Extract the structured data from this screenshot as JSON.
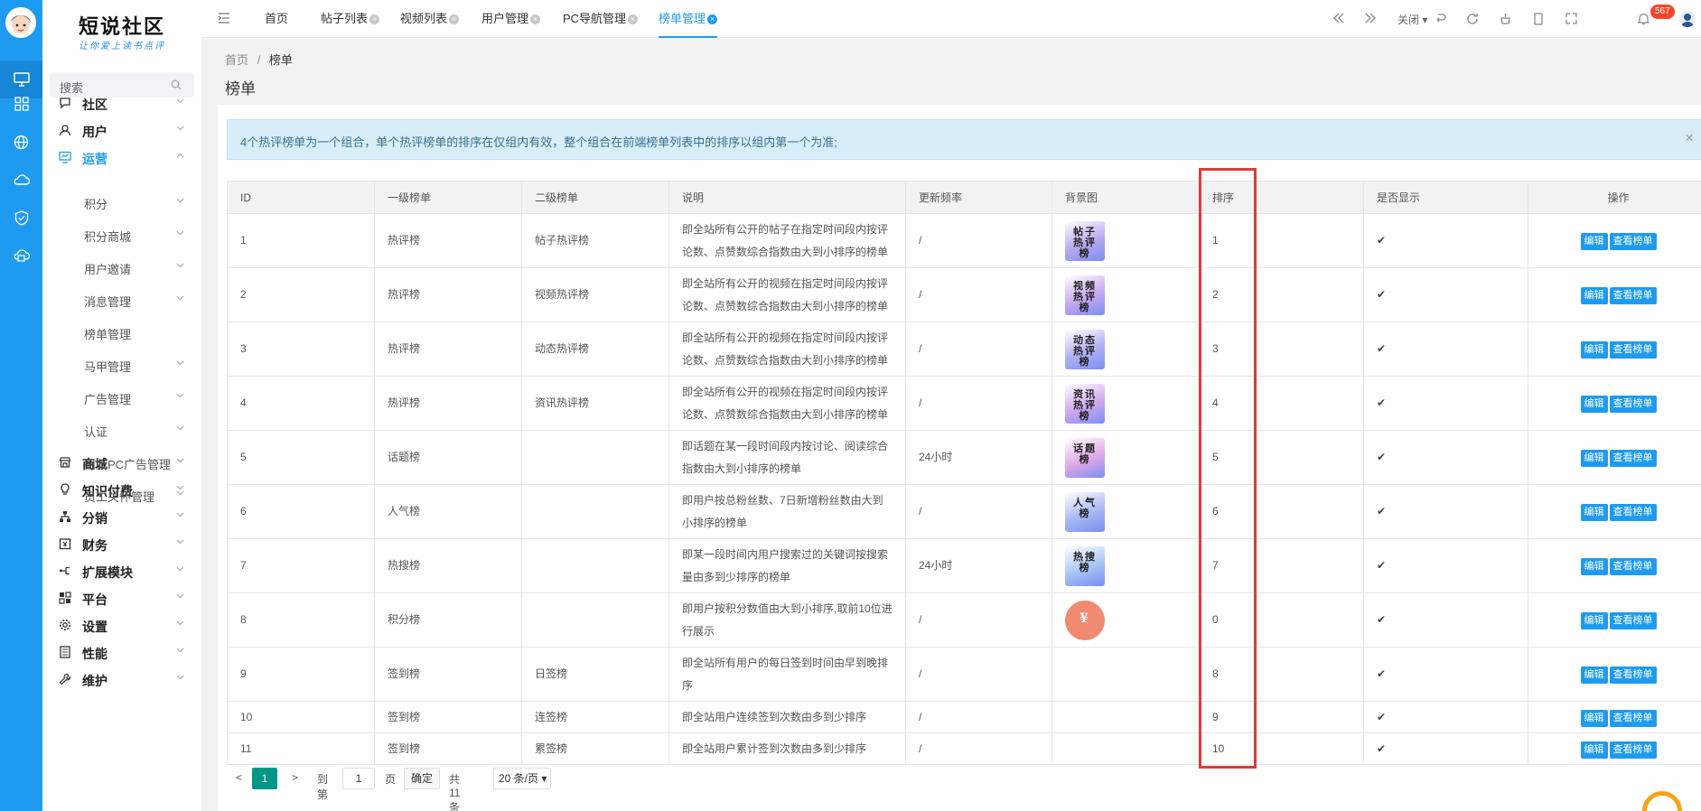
{
  "brand": {
    "name": "短说社区",
    "slogan": "让你爱上读书点评"
  },
  "sidebar": {
    "search_placeholder": "搜索",
    "menu": [
      {
        "label": "社区",
        "icon": "chat-icon",
        "open": false
      },
      {
        "label": "用户",
        "icon": "user-icon",
        "open": false
      },
      {
        "label": "运营",
        "icon": "monitor-chart-icon",
        "open": true
      },
      {
        "label": "商城",
        "icon": "store-icon",
        "open": false
      },
      {
        "label": "知识付费",
        "icon": "bulb-icon",
        "open": false
      },
      {
        "label": "分销",
        "icon": "network-icon",
        "open": false
      },
      {
        "label": "财务",
        "icon": "finance-icon",
        "open": false
      },
      {
        "label": "扩展模块",
        "icon": "extension-icon",
        "open": false
      },
      {
        "label": "平台",
        "icon": "grid-icon",
        "open": false
      },
      {
        "label": "设置",
        "icon": "gear-icon",
        "open": false
      },
      {
        "label": "性能",
        "icon": "server-icon",
        "open": false
      },
      {
        "label": "维护",
        "icon": "wrench-icon",
        "open": false
      }
    ],
    "submenu": [
      {
        "label": "积分",
        "has_children": true
      },
      {
        "label": "积分商城",
        "has_children": true
      },
      {
        "label": "用户邀请",
        "has_children": true
      },
      {
        "label": "消息管理",
        "has_children": true
      },
      {
        "label": "榜单管理",
        "has_children": false
      },
      {
        "label": "马甲管理",
        "has_children": true
      },
      {
        "label": "广告管理",
        "has_children": true
      },
      {
        "label": "认证",
        "has_children": true
      },
      {
        "label": "旧版PC广告管理",
        "has_children": true
      },
      {
        "label": "员工关怀管理",
        "has_children": true
      }
    ]
  },
  "tabs": [
    {
      "label": "首页",
      "closable": false
    },
    {
      "label": "帖子列表",
      "closable": true
    },
    {
      "label": "视频列表",
      "closable": true
    },
    {
      "label": "用户管理",
      "closable": true
    },
    {
      "label": "PC导航管理",
      "closable": true
    },
    {
      "label": "榜单管理",
      "closable": true,
      "active": true
    }
  ],
  "topbar": {
    "close_label": "关闭",
    "notification_count": "567"
  },
  "breadcrumb": {
    "home": "首页",
    "sep": "/",
    "current": "榜单"
  },
  "page_title": "榜单",
  "alert": {
    "text": "4个热评榜单为一个组合，单个热评榜单的排序在仅组内有效，整个组合在前端榜单列表中的排序以组内第一个为准;",
    "close": "×"
  },
  "table": {
    "headers": [
      "ID",
      "一级榜单",
      "二级榜单",
      "说明",
      "更新频率",
      "背景图",
      "排序",
      "是否显示",
      "操作"
    ],
    "rows": [
      {
        "id": "1",
        "l1": "热评榜",
        "l2": "帖子热评榜",
        "desc": "即全站所有公开的帖子在指定时间段内按评论数、点赞数综合指数由大到小排序的榜单",
        "freq": "/",
        "bg": {
          "text": "帖子\n热评\n榜",
          "color": "#b8a8f0"
        },
        "sort": "1",
        "show": "✔"
      },
      {
        "id": "2",
        "l1": "热评榜",
        "l2": "视频热评榜",
        "desc": "即全站所有公开的视频在指定时间段内按评论数、点赞数综合指数由大到小排序的榜单",
        "freq": "/",
        "bg": {
          "text": "视频\n热评\n榜",
          "color": "#c8a8f0"
        },
        "sort": "2",
        "show": "✔"
      },
      {
        "id": "3",
        "l1": "热评榜",
        "l2": "动态热评榜",
        "desc": "即全站所有公开的视频在指定时间段内按评论数、点赞数综合指数由大到小排序的榜单",
        "freq": "/",
        "bg": {
          "text": "动态\n热评\n榜",
          "color": "#b0b0f4"
        },
        "sort": "3",
        "show": "✔"
      },
      {
        "id": "4",
        "l1": "热评榜",
        "l2": "资讯热评榜",
        "desc": "即全站所有公开的视频在指定时间段内按评论数、点赞数综合指数由大到小排序的榜单",
        "freq": "/",
        "bg": {
          "text": "资讯\n热评\n榜",
          "color": "#d0a8ee"
        },
        "sort": "4",
        "show": "✔"
      },
      {
        "id": "5",
        "l1": "话题榜",
        "l2": "",
        "desc": "即话题在某一段时间段内按讨论、阅读综合指数由大到小排序的榜单",
        "freq": "24小时",
        "bg": {
          "text": "话题\n榜",
          "color": "#e0a8e8"
        },
        "sort": "5",
        "show": "✔"
      },
      {
        "id": "6",
        "l1": "人气榜",
        "l2": "",
        "desc": "即用户按总粉丝数、7日新增粉丝数由大到小排序的榜单",
        "freq": "/",
        "bg": {
          "text": "人气\n榜",
          "color": "#a8b8f4"
        },
        "sort": "6",
        "show": "✔"
      },
      {
        "id": "7",
        "l1": "热搜榜",
        "l2": "",
        "desc": "即某一段时间内用户搜索过的关键词按搜索量由多到少排序的榜单",
        "freq": "24小时",
        "bg": {
          "text": "热搜\n榜",
          "color": "#a8c4f4"
        },
        "sort": "7",
        "show": "✔"
      },
      {
        "id": "8",
        "l1": "积分榜",
        "l2": "",
        "desc": "即用户按积分数值由大到小排序,取前10位进行展示",
        "freq": "/",
        "bg": {
          "text": "¥",
          "color": "#f08a70",
          "round": true
        },
        "sort": "0",
        "show": "✔"
      },
      {
        "id": "9",
        "l1": "签到榜",
        "l2": "日签榜",
        "desc": "即全站所有用户的每日签到时间由早到晚排序",
        "freq": "/",
        "bg": null,
        "sort": "8",
        "show": "✔"
      },
      {
        "id": "10",
        "l1": "签到榜",
        "l2": "连签榜",
        "desc": "即全站用户连续签到次数由多到少排序",
        "freq": "/",
        "bg": null,
        "sort": "9",
        "show": "✔"
      },
      {
        "id": "11",
        "l1": "签到榜",
        "l2": "累签榜",
        "desc": "即全站用户累计签到次数由多到少排序",
        "freq": "/",
        "bg": null,
        "sort": "10",
        "show": "✔"
      }
    ],
    "actions": {
      "edit": "编辑",
      "view": "查看榜单"
    }
  },
  "pagination": {
    "current": "1",
    "goto_label": "到第",
    "page_value": "1",
    "page_unit": "页",
    "confirm": "确定",
    "total": "共 11 条",
    "per_page": "20 条/页"
  },
  "colors": {
    "primary": "#1e9bf0",
    "rail": "#1e9bf0",
    "pager_active": "#009688",
    "highlight_box": "#e03a3a"
  }
}
